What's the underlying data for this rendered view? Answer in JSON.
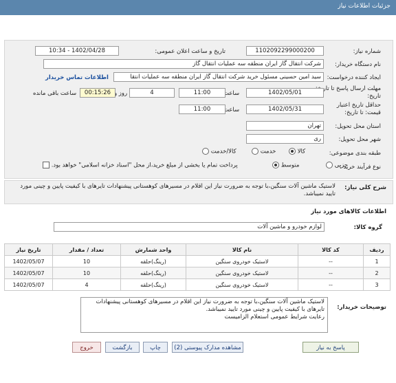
{
  "window": {
    "title": "جزئیات اطلاعات نیاز"
  },
  "fields": {
    "need_number": {
      "label": "شماره نیاز:",
      "value": "1102092299000200"
    },
    "announce": {
      "label": "تاریخ و ساعت اعلان عمومی:",
      "value": "1402/04/28 - 10:34"
    },
    "buyer_name": {
      "label": "نام دستگاه خریدار:",
      "value": "شرکت انتقال گاز ایران منطقه سه عملیات انتقال گاز"
    },
    "requester": {
      "label": "ایجاد کننده درخواست:",
      "value": "سید امین حسینی مسئول خرید شرکت انتقال گاز ایران منطقه سه عملیات انتقا"
    },
    "buyer_contact": {
      "label": "اطلاعات تماس خریدار"
    },
    "deadline": {
      "label": "مهلت ارسال پاسخ تا تاریخ:",
      "label_line2": "تاریخ:",
      "date": "1402/05/01",
      "time_label": "ساعت",
      "time": "11:00",
      "days": "4",
      "days_label": "روز و",
      "remaining": "00:15:26",
      "remaining_label": "ساعت باقی مانده"
    },
    "validity": {
      "label": "حداقل تاریخ اعتبار",
      "label_line2": "قیمت: تا تاریخ:",
      "date": "1402/05/31",
      "time_label": "ساعت",
      "time": "11:00"
    },
    "province": {
      "label": "استان محل تحویل:",
      "value": "تهران"
    },
    "city": {
      "label": "شهر محل تحویل:",
      "value": "ری"
    },
    "category": {
      "label": "طبقه بندی موضوعی:",
      "options": [
        "کالا",
        "خدمت",
        "کالا/خدمت"
      ],
      "selected": "کالا"
    },
    "process": {
      "label": "نوع فرآیند خرید :",
      "options": [
        "جزیی",
        "متوسط"
      ],
      "selected": "متوسط",
      "note": "پرداخت تمام یا بخشی از مبلغ خرید،از محل \"اسناد خزانه اسلامی\" خواهد بود."
    }
  },
  "general_description": {
    "label": "شرح کلی نیاز:",
    "text": "لاستیک ماشین آلات سنگین،با توجه به ضرورت نیاز این اقلام در مسیرهای کوهستانی پیشنهادات تایرهای با کیفیت پایین و چینی مورد تایید نمیباشد."
  },
  "goods_section": {
    "title": "اطلاعات کالاهای مورد نیاز"
  },
  "goods_group": {
    "label": "گروه کالا:",
    "value": "لوازم خودرو و ماشین آلات"
  },
  "table": {
    "headers": [
      "ردیف",
      "کد کالا",
      "نام کالا",
      "واحد شمارش",
      "تعداد / مقدار",
      "تاریخ نیاز"
    ],
    "rows": [
      {
        "row": "1",
        "code": "--",
        "name": "لاستیک خودروی سنگین",
        "unit": "(رینگ)حلقه",
        "qty": "10",
        "date": "1402/05/07"
      },
      {
        "row": "2",
        "code": "--",
        "name": "لاستیک خودروی سنگین",
        "unit": "(رینگ)حلقه",
        "qty": "10",
        "date": "1402/05/07"
      },
      {
        "row": "3",
        "code": "--",
        "name": "لاستیک خودروی سنگین",
        "unit": "(رینگ)حلقه",
        "qty": "4",
        "date": "1402/05/07"
      }
    ]
  },
  "buyer_notes": {
    "label": "توضیحات خریدار:",
    "line1": "لاستیک ماشین آلات سنگین،با توجه به ضرورت نیاز این اقلام در مسیرهای کوهستانی پیشنهادات",
    "line2": "تایرهای با کیفیت پایین و چینی مورد تایید نمیباشد.",
    "line3": "رعایت شرایط عمومی استعلام الزامیست"
  },
  "buttons": {
    "reply": "پاسخ به نیاز",
    "docs": "مشاهده مدارک پیوستی (2)",
    "print": "چاپ",
    "back": "بازگشت",
    "exit": "خروج"
  }
}
